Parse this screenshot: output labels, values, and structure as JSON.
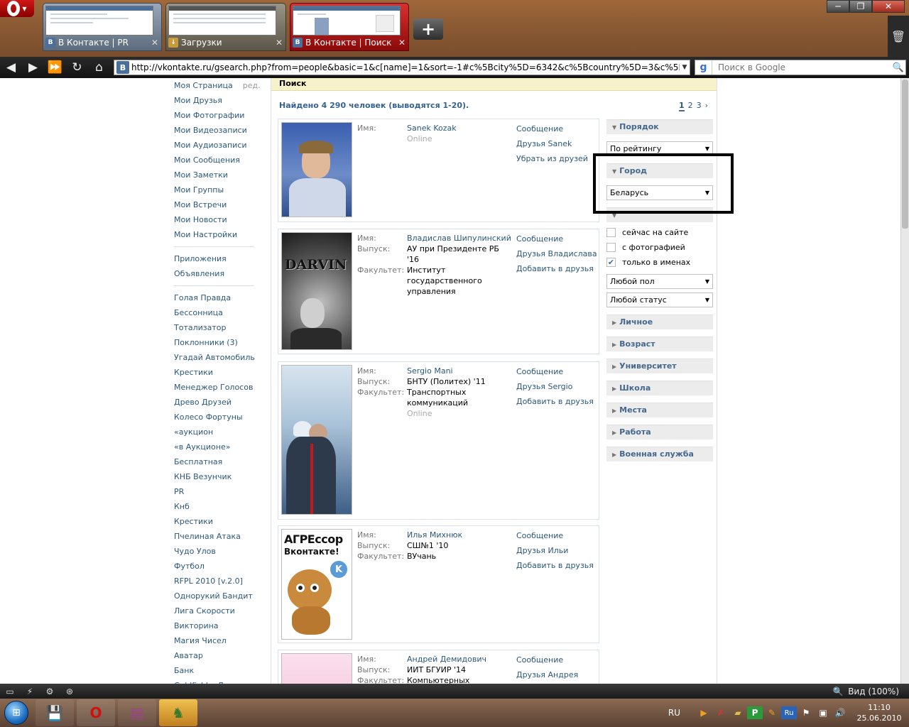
{
  "browser": {
    "tabs": [
      {
        "title": "В Контакте | PR",
        "favicon": "vk-favicon"
      },
      {
        "title": "Загрузки",
        "favicon": "downloads-favicon"
      },
      {
        "title": "В Контакте | Поиск",
        "favicon": "vk-favicon",
        "active": true
      }
    ],
    "new_tab_label": "+",
    "url": "http://vkontakte.ru/gsearch.php?from=people&basic=1&c[name]=1&sort=-1#c%5Bcity%5D=6342&c%5Bcountry%5D=3&c%5Bname%5D=1&c%",
    "search_placeholder": "Поиск в Google",
    "zoom_label": "Вид (100%)"
  },
  "left_menu": {
    "my_page": "Моя Страница",
    "edit": "ред.",
    "items": [
      "Мои Друзья",
      "Мои Фотографии",
      "Мои Видеозаписи",
      "Мои Аудиозаписи",
      "Мои Сообщения",
      "Мои Заметки",
      "Мои Группы",
      "Мои Встречи",
      "Мои Новости",
      "Мои Настройки"
    ],
    "section2": [
      "Приложения",
      "Объявления"
    ],
    "apps": [
      "Голая Правда",
      "Бессонница",
      "Тотализатор",
      "Поклонники",
      "Угадай Автомобиль",
      "Крестики",
      "Менеджер Голосов",
      "Древо Друзей",
      "Колесо Фортуны",
      "«аукцион",
      "«в Аукционе»",
      "Бесплатная",
      "КНБ Везунчик",
      "PR",
      "Кнб",
      "Крестики",
      "Пчелиная Атака",
      "Чудо Улов",
      "Футбол",
      "RFPL 2010 [v.2.0]",
      "Однорукий Бандит",
      "Лига Скорости",
      "Викторина",
      "Магия Чисел",
      "Аватар",
      "Банк",
      "Goldfishka Лото"
    ],
    "fans_count": "(3)"
  },
  "search": {
    "header": "Поиск",
    "found_text": "Найдено 4 290 человек (выводятся 1-20).",
    "pages": [
      "1",
      "2",
      "3",
      "›"
    ]
  },
  "labels": {
    "name": "Имя:",
    "grad": "Выпуск:",
    "faculty": "Факультет:",
    "online": "Online",
    "message": "Сообщение"
  },
  "results": [
    {
      "name": "Sanek Kozak",
      "online": true,
      "actions": [
        "Сообщение",
        "Друзья Sanek",
        "Убрать из друзей"
      ]
    },
    {
      "name": "Владислав Шипулинский",
      "grad": "АУ при Президенте РБ '16",
      "faculty": "Институт государственного управления",
      "actions": [
        "Сообщение",
        "Друзья Владислава",
        "Добавить в друзья"
      ],
      "photo_text": "DARVIN"
    },
    {
      "name": "Sergio Mani",
      "grad": "БНТУ (Политех) '11",
      "faculty": "Транспортных коммуникаций",
      "online": true,
      "actions": [
        "Сообщение",
        "Друзья Sergio",
        "Добавить в друзья"
      ]
    },
    {
      "name": "Илья Михнюк",
      "grad": "СШ№1 '10",
      "faculty": "ВУчань",
      "actions": [
        "Сообщение",
        "Друзья Ильи",
        "Добавить в друзья"
      ],
      "photo_text_1": "АГРЕссор",
      "photo_text_2": "Вконтакте!"
    },
    {
      "name": "Андрей Демидович",
      "grad": "ИИТ БГУИР '14",
      "faculty": "Компьютерных технологий",
      "actions": [
        "Сообщение",
        "Друзья Андрея"
      ]
    }
  ],
  "filters": {
    "order_head": "Порядок",
    "order_value": "По рейтингу",
    "city_head": "Город",
    "city_value": "Беларусь",
    "checkboxes": [
      {
        "label": "сейчас на сайте",
        "checked": false
      },
      {
        "label": "с фотографией",
        "checked": false
      },
      {
        "label": "только в именах",
        "checked": true
      }
    ],
    "gender_value": "Любой пол",
    "status_value": "Любой статус",
    "sections": [
      "Личное",
      "Возраст",
      "Университет",
      "Школа",
      "Места",
      "Работа",
      "Военная служба"
    ]
  },
  "taskbar": {
    "lang": "RU",
    "tray_lang": "Ru",
    "time": "11:10",
    "date": "25.06.2010"
  },
  "colors": {
    "link": "#2b587a",
    "highlight_border": "#000000",
    "vk_blue": "#4a6f9a"
  }
}
